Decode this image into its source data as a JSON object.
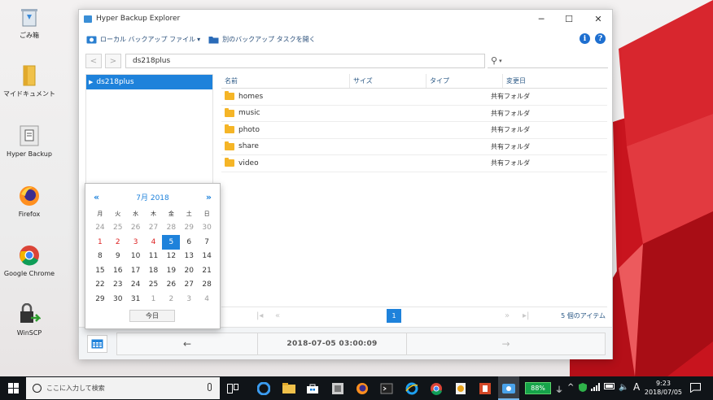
{
  "desktop": {
    "icons": [
      {
        "label": "ごみ箱",
        "icon": "recycle-bin-icon"
      },
      {
        "label": "マイドキュメント",
        "icon": "folder-icon"
      },
      {
        "label": "Hyper Backup",
        "icon": "document-icon"
      },
      {
        "label": "Firefox",
        "icon": "firefox-icon"
      },
      {
        "label": "Google Chrome",
        "icon": "chrome-icon"
      },
      {
        "label": "WinSCP",
        "icon": "winscp-icon"
      }
    ]
  },
  "window": {
    "title": "Hyper Backup Explorer",
    "minimize": "─",
    "maximize": "☐",
    "close": "✕",
    "toolbar": {
      "local_backup_label": "ローカル バックアップ ファイル",
      "local_backup_caret": "▾",
      "open_other_label": "別のバックアップ タスクを開く",
      "info_label": "i",
      "help_label": "?"
    },
    "nav": {
      "back": "<",
      "forward": ">",
      "path": "ds218plus",
      "search_icon": "⚲",
      "search_caret": "▾"
    },
    "tree": {
      "items": [
        {
          "label": "ds218plus",
          "arrow": "▶"
        }
      ]
    },
    "filelist": {
      "columns": [
        "名前",
        "サイズ",
        "タイプ",
        "変更日"
      ],
      "rows": [
        {
          "name": "homes",
          "size": "",
          "type": "共有フォルダ",
          "modified": ""
        },
        {
          "name": "music",
          "size": "",
          "type": "共有フォルダ",
          "modified": ""
        },
        {
          "name": "photo",
          "size": "",
          "type": "共有フォルダ",
          "modified": ""
        },
        {
          "name": "share",
          "size": "",
          "type": "共有フォルダ",
          "modified": ""
        },
        {
          "name": "video",
          "size": "",
          "type": "共有フォルダ",
          "modified": ""
        }
      ]
    },
    "pager": {
      "first": "|◂",
      "prev": "«",
      "page": "1",
      "next": "»",
      "last": "▸|",
      "count": "5 個のアイテム"
    },
    "bottom": {
      "prev_version": "←",
      "datetime": "2018-07-05 03:00:09",
      "next_version": "→"
    }
  },
  "calendar": {
    "prev": "«",
    "next": "»",
    "month_label": "7月 2018",
    "weekdays": [
      "月",
      "火",
      "水",
      "木",
      "金",
      "土",
      "日"
    ],
    "weeks": [
      [
        {
          "d": "24",
          "s": "other"
        },
        {
          "d": "25",
          "s": "other"
        },
        {
          "d": "26",
          "s": "other"
        },
        {
          "d": "27",
          "s": "other"
        },
        {
          "d": "28",
          "s": "other"
        },
        {
          "d": "29",
          "s": "other"
        },
        {
          "d": "30",
          "s": "other"
        }
      ],
      [
        {
          "d": "1",
          "s": "red"
        },
        {
          "d": "2",
          "s": "red"
        },
        {
          "d": "3",
          "s": "red"
        },
        {
          "d": "4",
          "s": "red"
        },
        {
          "d": "5",
          "s": "sel"
        },
        {
          "d": "6",
          "s": ""
        },
        {
          "d": "7",
          "s": ""
        }
      ],
      [
        {
          "d": "8",
          "s": ""
        },
        {
          "d": "9",
          "s": ""
        },
        {
          "d": "10",
          "s": ""
        },
        {
          "d": "11",
          "s": ""
        },
        {
          "d": "12",
          "s": ""
        },
        {
          "d": "13",
          "s": ""
        },
        {
          "d": "14",
          "s": ""
        }
      ],
      [
        {
          "d": "15",
          "s": ""
        },
        {
          "d": "16",
          "s": ""
        },
        {
          "d": "17",
          "s": ""
        },
        {
          "d": "18",
          "s": ""
        },
        {
          "d": "19",
          "s": ""
        },
        {
          "d": "20",
          "s": ""
        },
        {
          "d": "21",
          "s": ""
        }
      ],
      [
        {
          "d": "22",
          "s": ""
        },
        {
          "d": "23",
          "s": ""
        },
        {
          "d": "24",
          "s": ""
        },
        {
          "d": "25",
          "s": ""
        },
        {
          "d": "26",
          "s": ""
        },
        {
          "d": "27",
          "s": ""
        },
        {
          "d": "28",
          "s": ""
        }
      ],
      [
        {
          "d": "29",
          "s": ""
        },
        {
          "d": "30",
          "s": ""
        },
        {
          "d": "31",
          "s": ""
        },
        {
          "d": "1",
          "s": "other"
        },
        {
          "d": "2",
          "s": "other"
        },
        {
          "d": "3",
          "s": "other"
        },
        {
          "d": "4",
          "s": "other"
        }
      ]
    ],
    "today_label": "今日"
  },
  "taskbar": {
    "search_placeholder": "ここに入力して検索",
    "battery": "88%",
    "ime": "A",
    "time": "9:23",
    "date": "2018/07/05"
  },
  "colors": {
    "accent": "#1e82db",
    "folder": "#f5b527",
    "holiday": "#dd2222",
    "battery": "#16a34a"
  }
}
